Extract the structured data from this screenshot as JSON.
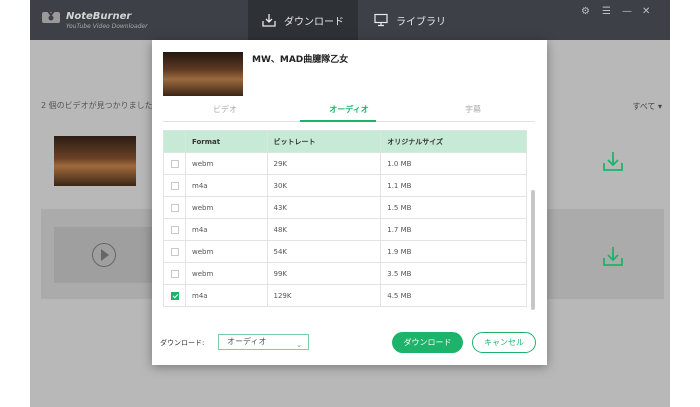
{
  "app": {
    "name": "NoteBurner",
    "subtitle": "YouTube Video Downloader"
  },
  "nav": {
    "tabs": [
      {
        "label": "ダウンロード",
        "icon": "download-tray-icon",
        "active": true
      },
      {
        "label": "ライブラリ",
        "icon": "monitor-icon",
        "active": false
      }
    ]
  },
  "window_controls": [
    "gear-icon",
    "menu-icon",
    "minimize-icon",
    "close-icon"
  ],
  "main": {
    "found_text": "2 個のビデオが見つかりました",
    "filter_label": "すべて",
    "videos": [
      {
        "thumbnail": "video-thumbnail",
        "action_icon": "download-icon"
      },
      {
        "thumbnail": "video-placeholder-play",
        "action_icon": "download-icon"
      }
    ]
  },
  "dialog": {
    "title": "MW、MAD曲臆隊乙女",
    "tabs": [
      {
        "label": "ビデオ",
        "active": false
      },
      {
        "label": "オーディオ",
        "active": true
      },
      {
        "label": "字幕",
        "active": false
      }
    ],
    "table": {
      "headers": [
        "Format",
        "ビットレート",
        "オリジナルサイズ"
      ],
      "rows": [
        {
          "checked": false,
          "format": "webm",
          "bitrate": "29K",
          "size": "1.0 MB"
        },
        {
          "checked": false,
          "format": "m4a",
          "bitrate": "30K",
          "size": "1.1 MB"
        },
        {
          "checked": false,
          "format": "webm",
          "bitrate": "43K",
          "size": "1.5 MB"
        },
        {
          "checked": false,
          "format": "m4a",
          "bitrate": "48K",
          "size": "1.7 MB"
        },
        {
          "checked": false,
          "format": "webm",
          "bitrate": "54K",
          "size": "1.9 MB"
        },
        {
          "checked": false,
          "format": "webm",
          "bitrate": "99K",
          "size": "3.5 MB"
        },
        {
          "checked": true,
          "format": "m4a",
          "bitrate": "129K",
          "size": "4.5 MB"
        }
      ]
    },
    "download_label": "ダウンロード:",
    "download_select": "オーディオ",
    "download_button": "ダウンロード",
    "cancel_button": "キャンセル"
  },
  "colors": {
    "accent": "#1db36a",
    "header_row": "#c6ead6",
    "titlebar": "#3d4147"
  }
}
